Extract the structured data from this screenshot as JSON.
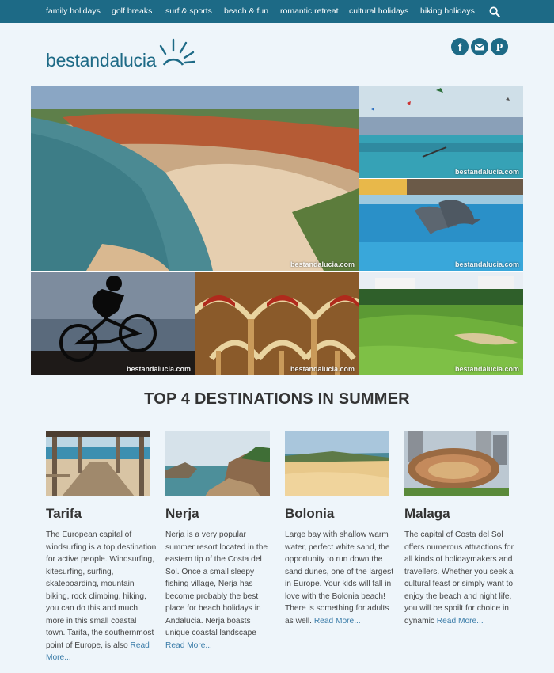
{
  "nav": {
    "items": [
      "family holidays",
      "golf breaks",
      "surf & sports",
      "beach & fun",
      "romantic retreat",
      "cultural holidays",
      "hiking holidays"
    ],
    "search_icon": "search-icon"
  },
  "logo": {
    "text": "bestandalucia"
  },
  "social": [
    {
      "icon": "facebook-icon",
      "glyph": "f"
    },
    {
      "icon": "email-icon",
      "glyph": ""
    },
    {
      "icon": "pinterest-icon",
      "glyph": "P"
    }
  ],
  "hero": {
    "watermark": "bestandalucia.com"
  },
  "section": {
    "title": "TOP 4 DESTINATIONS IN SUMMER"
  },
  "cards": [
    {
      "title": "Tarifa",
      "desc": "The European capital of windsurfing is a top destination for active people. Windsurfing, kitesurfing, surfing, skateboarding, mountain biking, rock climbing, hiking, you can do this and much more in this small coastal town. Tarifa, the southernmost point of Europe, is also",
      "more": "Read More..."
    },
    {
      "title": "Nerja",
      "desc": "Nerja is a very popular summer resort located in the eastern tip of the Costa del Sol. Once a small sleepy fishing village, Nerja has become probably the best place for beach holidays in Andalucia. Nerja boasts unique coastal landscape",
      "more": "Read More..."
    },
    {
      "title": "Bolonia",
      "desc": "Large bay with shallow warm water, perfect white sand, the opportunity to run down the sand dunes, one of the largest in Europe. Your kids will fall in love with the Bolonia beach! There is something for adults as well.",
      "more": "Read More..."
    },
    {
      "title": "Malaga",
      "desc": "The capital of Costa del Sol offers numerous attractions for all kinds of holidaymakers and travellers. Whether you seek a cultural feast or simply want to enjoy the beach and night life, you will be spoilt for choice in dynamic",
      "more": "Read More..."
    }
  ],
  "colors": {
    "nav_bg": "#1d6a86",
    "page_bg": "#eef5fa",
    "link": "#3a7ca8"
  }
}
